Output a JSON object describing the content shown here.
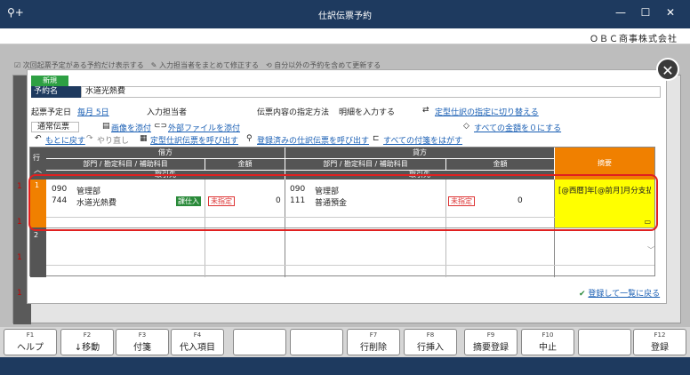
{
  "window": {
    "title": "仕訳伝票予約",
    "company": "ＯＢＣ商事株式会社",
    "logo": "⚲+"
  },
  "background": {
    "options": "☑ 次回起票予定がある予約だけ表示する　✎ 入力担当者をまとめて修正する　⟲ 自分以外の予約を含めて更新する",
    "row_numbers": [
      "1",
      "1",
      "1",
      "1"
    ]
  },
  "modal": {
    "badge": "新規",
    "yoyaku_label": "予約名",
    "yoyaku_value": "水道光熱費",
    "kihyo_label": "起票予定日",
    "kihyo_value": "毎月 5日",
    "tanto_label": "入力担当者",
    "shitei_label": "伝票内容の指定方法",
    "shitei_value": "明細を入力する",
    "teikei_link": "定型仕訳の指定に切り替える",
    "tsujo": "通常伝票",
    "img_link": "画像を添付",
    "file_link": "外部ファイルを添付",
    "zero_link": "すべての金額を０にする",
    "undo": "もとに戻す",
    "redo": "やり直し",
    "teikei_call": "定型仕訳伝票を呼び出す",
    "registered_call": "登録済みの仕訳伝票を呼び出す",
    "remove_tags": "すべての付箋をはがす",
    "footer_link": "登録して一覧に戻る"
  },
  "grid": {
    "row_label": "行",
    "debit": "借方",
    "credit": "貸方",
    "dept_col": "部門 / 勘定科目 / 補助科目",
    "amount_col": "金額",
    "partner_col": "取引先",
    "summary_col": "摘要",
    "rows": [
      {
        "no": "1",
        "debit_dept_code": "090",
        "debit_dept": "管理部",
        "debit_acct_code": "744",
        "debit_acct": "水道光熱費",
        "debit_tax": "課仕入",
        "debit_sub": "未指定",
        "debit_amount": "0",
        "credit_dept_code": "090",
        "credit_dept": "管理部",
        "credit_acct_code": "111",
        "credit_acct": "普通預金",
        "credit_sub": "未指定",
        "credit_amount": "0",
        "summary": "[@西暦]年[@前月]月分支払い"
      },
      {
        "no": "2"
      }
    ]
  },
  "fkeys": [
    {
      "fn": "F1",
      "label": "ヘルプ"
    },
    {
      "fn": "F2",
      "label": "↓移動"
    },
    {
      "fn": "F3",
      "label": "付箋"
    },
    {
      "fn": "F4",
      "label": "代入項目"
    },
    {
      "fn": "",
      "label": ""
    },
    {
      "fn": "",
      "label": ""
    },
    {
      "fn": "F7",
      "label": "行削除"
    },
    {
      "fn": "F8",
      "label": "行挿入"
    },
    {
      "fn": "F9",
      "label": "摘要登録"
    },
    {
      "fn": "F10",
      "label": "中止"
    },
    {
      "fn": "",
      "label": ""
    },
    {
      "fn": "F12",
      "label": "登録"
    }
  ]
}
